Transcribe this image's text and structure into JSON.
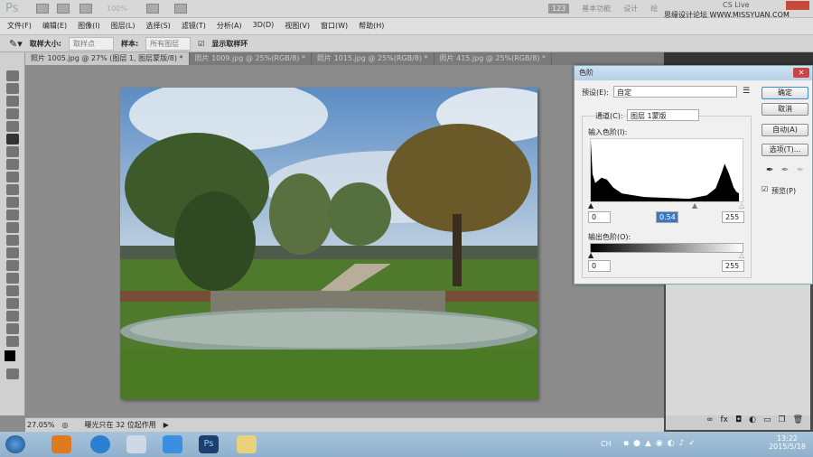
{
  "app": {
    "logo": "Ps",
    "zoom_select": "100%",
    "workspace_badge": "123",
    "workspaces": [
      "基本功能",
      "设计",
      "绘"
    ],
    "cs_live": "CS Live",
    "watermark": "思缘设计论坛 WWW.MISSYUAN.COM"
  },
  "menu": [
    "文件(F)",
    "编辑(E)",
    "图像(I)",
    "图层(L)",
    "选择(S)",
    "滤镜(T)",
    "分析(A)",
    "3D(D)",
    "视图(V)",
    "窗口(W)",
    "帮助(H)"
  ],
  "options": {
    "sample_size_label": "取样大小:",
    "sample_size_value": "取样点",
    "sample_label": "样本:",
    "sample_value": "所有图层",
    "show_ring_label": "显示取样环",
    "show_ring_checked": true
  },
  "tabs": [
    {
      "label": "照片 1005.jpg @ 27% (图层 1, 图层蒙版/8) *",
      "active": true
    },
    {
      "label": "照片 1009.jpg @ 25%(RGB/8) *"
    },
    {
      "label": "照片 1015.jpg @ 25%(RGB/8) *"
    },
    {
      "label": "照片 415.jpg @ 25%(RGB/8) *"
    }
  ],
  "status": {
    "zoom": "27.05%",
    "info": "曝光只在 32 位起作用"
  },
  "levels_dialog": {
    "title": "色阶",
    "preset_label": "预设(E):",
    "preset_value": "自定",
    "channel_label": "通道(C):",
    "channel_value": "图层 1蒙版",
    "input_label": "输入色阶(I):",
    "input_black": "0",
    "input_gamma": "0.54",
    "input_white": "255",
    "output_label": "输出色阶(O):",
    "output_black": "0",
    "output_white": "255",
    "buttons": {
      "ok": "确定",
      "cancel": "取消",
      "auto": "自动(A)",
      "options": "选项(T)..."
    },
    "preview_label": "预览(P)",
    "preview_checked": true,
    "close": "✕"
  },
  "taskbar": {
    "time": "13:22",
    "date": "2015/5/18",
    "lang": "CH"
  }
}
